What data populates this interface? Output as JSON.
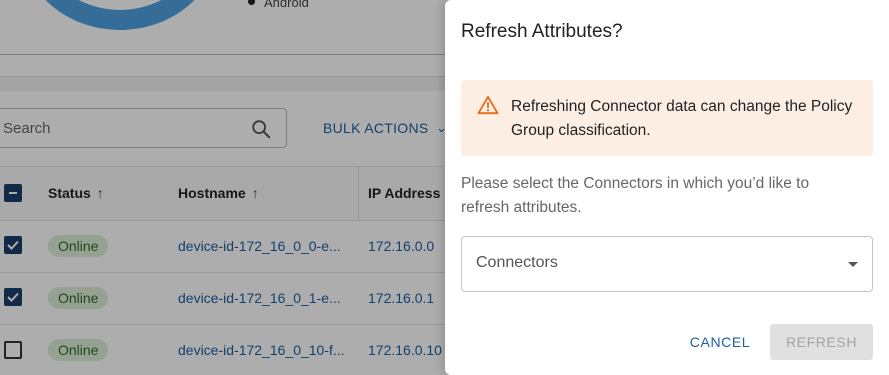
{
  "background": {
    "legend_item": "Android",
    "search": {
      "placeholder": "Search"
    },
    "bulk_actions_label": "BULK ACTIONS",
    "table": {
      "headers": {
        "status": "Status",
        "hostname": "Hostname",
        "ip": "IP Address"
      },
      "rows": [
        {
          "checked": true,
          "status": "Online",
          "hostname": "device-id-172_16_0_0-e...",
          "ip": "172.16.0.0"
        },
        {
          "checked": true,
          "status": "Online",
          "hostname": "device-id-172_16_0_1-e...",
          "ip": "172.16.0.1"
        },
        {
          "checked": false,
          "status": "Online",
          "hostname": "device-id-172_16_0_10-f...",
          "ip": "172.16.0.10"
        }
      ]
    },
    "colors": {
      "link": "#1d5fa0",
      "checkbox": "#1a3e6b",
      "status_pill": "#dcefd8",
      "chart": "#4f9fe0"
    }
  },
  "dialog": {
    "title": "Refresh Attributes?",
    "alert": {
      "icon": "warning-icon",
      "text": "Refreshing Connector data can change the Policy Group classification.",
      "color": "#fdeee4",
      "icon_color": "#e36d1a"
    },
    "help_text": "Please select the Connectors in which you’d like to refresh attributes.",
    "connectors_select": {
      "label": "Connectors",
      "value": ""
    },
    "buttons": {
      "cancel": "CANCEL",
      "refresh": "REFRESH"
    }
  }
}
